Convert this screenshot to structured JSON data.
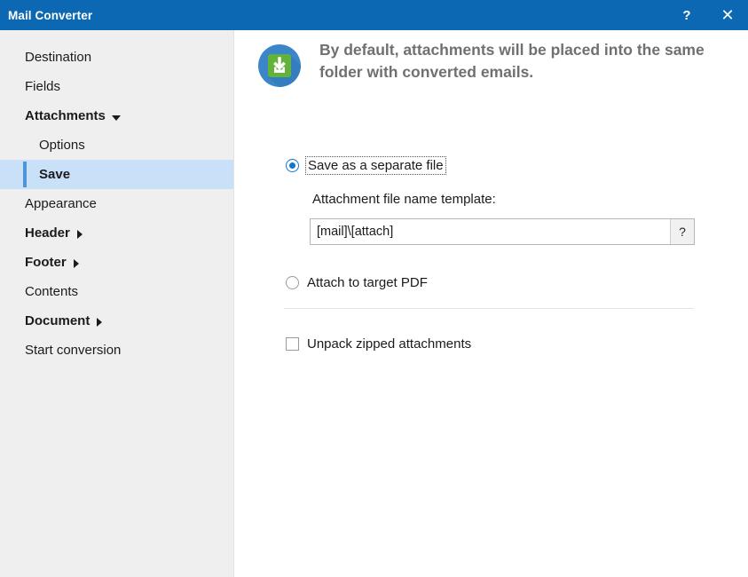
{
  "window": {
    "title": "Mail Converter",
    "help_button": "?",
    "close_button": "✕"
  },
  "sidebar": {
    "items": [
      {
        "label": "Destination",
        "level": "top",
        "bold": false,
        "selected": false,
        "caret": "none"
      },
      {
        "label": "Fields",
        "level": "top",
        "bold": false,
        "selected": false,
        "caret": "none"
      },
      {
        "label": "Attachments",
        "level": "top",
        "bold": true,
        "selected": false,
        "caret": "down"
      },
      {
        "label": "Options",
        "level": "sub",
        "bold": false,
        "selected": false,
        "caret": "none"
      },
      {
        "label": "Save",
        "level": "sub",
        "bold": true,
        "selected": true,
        "caret": "none"
      },
      {
        "label": "Appearance",
        "level": "top",
        "bold": false,
        "selected": false,
        "caret": "none"
      },
      {
        "label": "Header",
        "level": "top",
        "bold": true,
        "selected": false,
        "caret": "right"
      },
      {
        "label": "Footer",
        "level": "top",
        "bold": true,
        "selected": false,
        "caret": "right"
      },
      {
        "label": "Contents",
        "level": "top",
        "bold": false,
        "selected": false,
        "caret": "none"
      },
      {
        "label": "Document",
        "level": "top",
        "bold": true,
        "selected": false,
        "caret": "right"
      },
      {
        "label": "Start conversion",
        "level": "top",
        "bold": false,
        "selected": false,
        "caret": "none"
      }
    ]
  },
  "banner": {
    "icon": "download-to-folder-icon",
    "text": "By default, attachments will be placed into the same folder with converted emails."
  },
  "options": {
    "save_separate": {
      "label": "Save as a separate file",
      "checked": true,
      "focused": true
    },
    "template": {
      "label": "Attachment file name template:",
      "value": "[mail]\\[attach]",
      "placeholder": "",
      "help_button": "?"
    },
    "attach_pdf": {
      "label": "Attach to target PDF",
      "checked": false
    },
    "unpack_zip": {
      "label": "Unpack zipped attachments",
      "checked": false
    }
  },
  "colors": {
    "titlebar": "#0c68b3",
    "sidebar_bg": "#efeff0",
    "selection": "#c9e1f8",
    "selection_accent": "#4d95d8",
    "banner_text": "#707070",
    "radio_accent": "#1076cf",
    "icon_circle": "#3a86c8",
    "icon_square": "#63b33b"
  }
}
